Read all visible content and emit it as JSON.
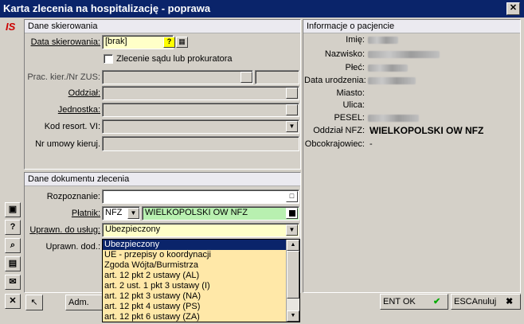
{
  "window": {
    "title": "Karta zlecenia na hospitalizację - poprawa",
    "close": "✕"
  },
  "logo": "IS",
  "sidebar": {
    "b1": "▣",
    "b2": "?",
    "b3": "⌕",
    "b4": "▤",
    "b5": "✉",
    "b6": "✕"
  },
  "dane_skierowania": {
    "header": "Dane skierowania",
    "data_label": "Data skierowania:",
    "data_value": "[brak]",
    "help_btn": "?",
    "cal_btn": "▦",
    "checkbox_label": "Zlecenie sądu lub prokuratora",
    "prac_label": "Prac. kier./Nr ZUS:",
    "oddzial_label": "Oddział:",
    "jednostka_label": "Jednostka:",
    "kod_label": "Kod resort. VI:",
    "nr_label": "Nr umowy kieruj."
  },
  "informacje": {
    "header": "Informacje o pacjencie",
    "imie": "Imię:",
    "nazwisko": "Nazwisko:",
    "plec": "Płeć:",
    "data_ur": "Data urodzenia:",
    "miasto": "Miasto:",
    "ulica": "Ulica:",
    "pesel": "PESEL:",
    "oddzial_nfz_label": "Oddział NFZ:",
    "oddzial_nfz_value": "WIELKOPOLSKI OW NFZ",
    "obcokrajowiec_label": "Obcokrajowiec:",
    "obcokrajowiec_value": "-"
  },
  "dane_dokumentu": {
    "header": "Dane dokumentu zlecenia",
    "rozpoznanie_label": "Rozpoznanie:",
    "platnik_label": "Płatnik:",
    "platnik_code": "NFZ",
    "platnik_name": "WIELKOPOLSKI OW NFZ",
    "uprawn_label": "Uprawn. do usług:",
    "uprawn_value": "Ubezpieczony",
    "uprawn_dod_label": "Uprawn. dod.:"
  },
  "dropdown": {
    "options": [
      "Ubezpieczony",
      "UE - przepisy o koordynacji",
      "Zgoda Wójta/Burmistrza",
      "art. 12 pkt 2 ustawy (AL)",
      "art. 2 ust. 1 pkt 3 ustawy (I)",
      "art. 12 pkt 3 ustawy (NA)",
      "art. 12 pkt 4 ustawy (PS)",
      "art. 12 pkt 6 ustawy (ZA)"
    ]
  },
  "bottom": {
    "back": "↖",
    "adm": "Adm.",
    "ok_key": "ENT",
    "ok_label": "OK",
    "ok_icon": "✔",
    "cancel_key": "ESC",
    "cancel_label": "Anuluj",
    "cancel_icon": "✖"
  }
}
